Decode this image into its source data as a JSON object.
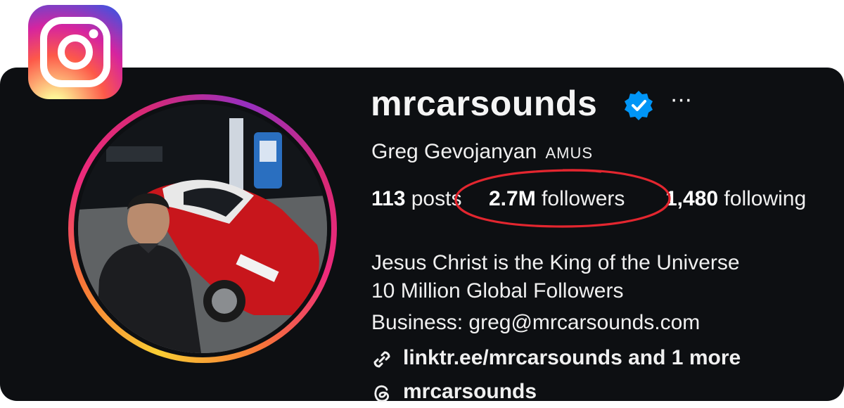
{
  "profile": {
    "username": "mrcarsounds",
    "full_name": "Greg Gevojanyan",
    "name_tag": "AMUS",
    "verified_icon": "verified-badge-icon",
    "more_icon": "more-options-icon",
    "more_label": "···"
  },
  "stats": {
    "posts_count": "113",
    "posts_label": "posts",
    "followers_count": "2.7M",
    "followers_label": "followers",
    "following_count": "1,480",
    "following_label": "following"
  },
  "bio": {
    "line1": "Jesus Christ is the King of the Universe",
    "line2": "10 Million Global Followers",
    "line3": "Business: greg@mrcarsounds.com",
    "link_text": "linktr.ee/mrcarsounds and 1 more",
    "threads_handle": "mrcarsounds"
  },
  "colors": {
    "card_background": "#0d0f12",
    "text": "#f0f0f0",
    "verified_blue": "#0095f6",
    "annotation_red": "#e3262f"
  }
}
